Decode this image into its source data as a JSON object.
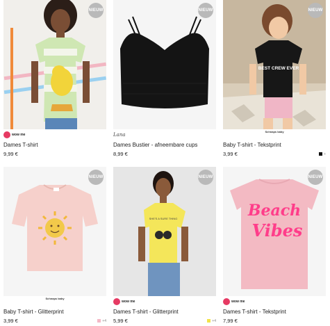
{
  "products": [
    {
      "badge": "NIEUW",
      "brand": "wow me",
      "name": "Dames T-shirt",
      "price": "9,99 €"
    },
    {
      "badge": "NIEUW",
      "brand": "Lana",
      "name": "Dames Bustier - afneembare cups",
      "price": "8,99 €"
    },
    {
      "badge": "NIEUW",
      "brand": "Schnaps baby",
      "name": "Baby T-shirt - Tekstprint",
      "price": "3,99 €",
      "swatch_color": "#111111",
      "more": "+"
    },
    {
      "badge": "NIEUW",
      "brand": "Schnaps baby",
      "name": "Baby T-shirt - Glitterprint",
      "price": "3,99 €",
      "swatch_color": "#f4b9c7",
      "more": "+4"
    },
    {
      "badge": "NIEUW",
      "brand": "wow me",
      "name": "Dames T-shirt - Glitterprint",
      "price": "5,99 €",
      "swatch_color": "#f2e24a",
      "more": "+4"
    },
    {
      "badge": "NIEUW",
      "brand": "wow me",
      "name": "Dames T-shirt - Tekstprint",
      "price": "7,99 €"
    }
  ],
  "graphics": {
    "tshirt3_text": "BEST CREW EVER",
    "tshirt6_text_line1": "Beach",
    "tshirt6_text_line2": "Vibes",
    "tshirt5_text": "SHE'S A SURE THING"
  },
  "colors": {
    "badge": "#b9b9b9",
    "brand_dot": "#e63a63",
    "pink_shirt": "#f3bac3",
    "yellow_shirt": "#f4e65a"
  }
}
